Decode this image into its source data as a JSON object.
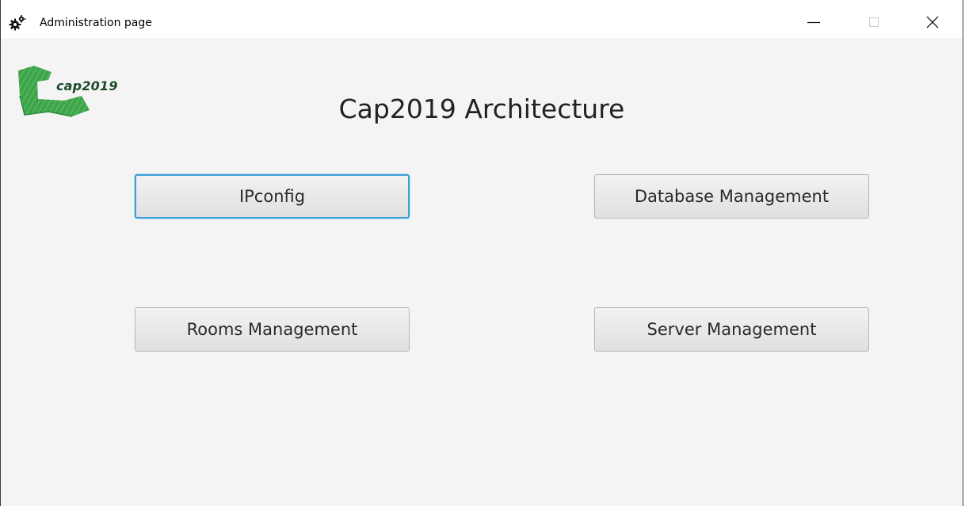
{
  "window": {
    "title": "Administration page",
    "controls": {
      "minimize": "minimize-icon",
      "maximize": "maximize-icon",
      "close": "close-icon"
    }
  },
  "logo": {
    "text": "cap2019",
    "colors": {
      "primary": "#3ea64a",
      "text": "#1b4a2a"
    }
  },
  "main": {
    "heading": "Cap2019 Architecture",
    "buttons": [
      {
        "label": "IPconfig",
        "focused": true
      },
      {
        "label": "Database Management",
        "focused": false
      },
      {
        "label": "Rooms Management",
        "focused": false
      },
      {
        "label": "Server Management",
        "focused": false
      }
    ]
  },
  "colors": {
    "focus_ring": "#3a9fd6",
    "background": "#f4f4f4"
  }
}
